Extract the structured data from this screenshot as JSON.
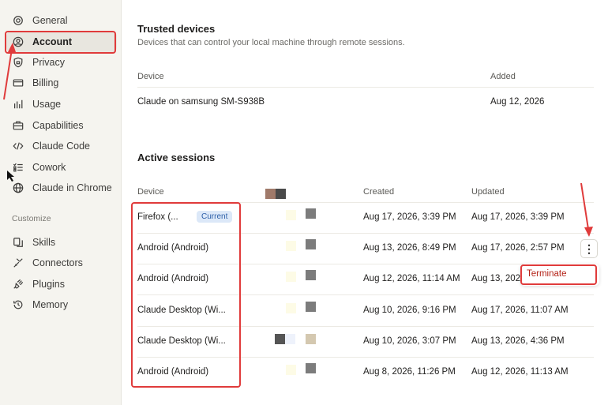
{
  "sidebar": {
    "items": [
      {
        "label": "General",
        "icon": "gear-icon"
      },
      {
        "label": "Account",
        "icon": "user-icon"
      },
      {
        "label": "Privacy",
        "icon": "shield-icon"
      },
      {
        "label": "Billing",
        "icon": "credit-card-icon"
      },
      {
        "label": "Usage",
        "icon": "bar-chart-icon"
      },
      {
        "label": "Capabilities",
        "icon": "briefcase-icon"
      },
      {
        "label": "Claude Code",
        "icon": "code-icon"
      },
      {
        "label": "Cowork",
        "icon": "checklist-icon"
      },
      {
        "label": "Claude in Chrome",
        "icon": "globe-icon"
      }
    ],
    "customize_label": "Customize",
    "customize_items": [
      {
        "label": "Skills",
        "icon": "skills-icon"
      },
      {
        "label": "Connectors",
        "icon": "connector-icon"
      },
      {
        "label": "Plugins",
        "icon": "plug-icon"
      },
      {
        "label": "Memory",
        "icon": "history-icon"
      }
    ]
  },
  "trusted": {
    "title": "Trusted devices",
    "subtitle": "Devices that can control your local machine through remote sessions.",
    "col_device": "Device",
    "col_added": "Added",
    "rows": [
      {
        "device": "Claude on samsung SM-S938B",
        "added": "Aug 12, 2026"
      }
    ]
  },
  "sessions": {
    "title": "Active sessions",
    "col_device": "Device",
    "col_created": "Created",
    "col_updated": "Updated",
    "current_badge": "Current",
    "rows": [
      {
        "device": "Firefox (...",
        "created": "Aug 17, 2026, 3:39 PM",
        "updated": "Aug 17, 2026, 3:39 PM"
      },
      {
        "device": "Android (Android)",
        "created": "Aug 13, 2026, 8:49 PM",
        "updated": "Aug 17, 2026, 2:57 PM"
      },
      {
        "device": "Android (Android)",
        "created": "Aug 12, 2026, 11:14 AM",
        "updated": "Aug 13, 202"
      },
      {
        "device": "Claude Desktop (Wi...",
        "created": "Aug 10, 2026, 9:16 PM",
        "updated": "Aug 17, 2026, 11:07 AM"
      },
      {
        "device": "Claude Desktop (Wi...",
        "created": "Aug 10, 2026, 3:07 PM",
        "updated": "Aug 13, 2026, 4:36 PM"
      },
      {
        "device": "Android (Android)",
        "created": "Aug 8, 2026, 11:26 PM",
        "updated": "Aug 12, 2026, 11:13 AM"
      }
    ]
  },
  "menu": {
    "terminate_label": "Terminate"
  },
  "colors": {
    "annotation": "#e03b3b",
    "badge_bg": "#dce8f8",
    "badge_text": "#2d5fa8",
    "terminate": "#b42318"
  }
}
